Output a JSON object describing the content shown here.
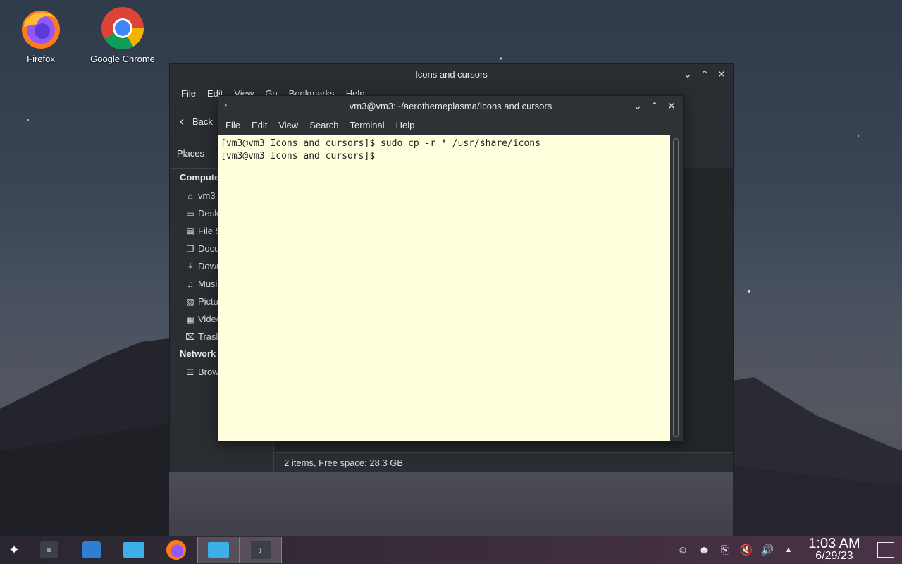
{
  "desktop": {
    "icons": [
      {
        "label": "Firefox",
        "icon": "firefox-icon"
      },
      {
        "label": "Google Chrome",
        "icon": "chrome-icon"
      }
    ]
  },
  "dolphin": {
    "title": "Icons and cursors",
    "menu": [
      "File",
      "Edit",
      "View",
      "Go",
      "Bookmarks",
      "Help"
    ],
    "back_label": "Back",
    "places_label": "Places",
    "sections": [
      {
        "title": "Computer",
        "items": [
          {
            "label": "vm3",
            "icon": "home-icon"
          },
          {
            "label": "Desktop",
            "icon": "desktop-icon"
          },
          {
            "label": "File System",
            "icon": "drive-icon"
          },
          {
            "label": "Documents",
            "icon": "documents-icon"
          },
          {
            "label": "Downloads",
            "icon": "download-icon"
          },
          {
            "label": "Music",
            "icon": "music-icon"
          },
          {
            "label": "Pictures",
            "icon": "pictures-icon"
          },
          {
            "label": "Videos",
            "icon": "videos-icon"
          },
          {
            "label": "Trash",
            "icon": "trash-icon"
          }
        ]
      },
      {
        "title": "Network",
        "items": [
          {
            "label": "Browse",
            "icon": "network-icon"
          }
        ]
      }
    ],
    "status": "2 items, Free space: 28.3 GB"
  },
  "terminal": {
    "title": "vm3@vm3:~/aerothemeplasma/Icons and cursors",
    "menu": [
      "File",
      "Edit",
      "View",
      "Search",
      "Terminal",
      "Help"
    ],
    "lines": [
      "[vm3@vm3 Icons and cursors]$ sudo cp -r * /usr/share/icons",
      "[vm3@vm3 Icons and cursors]$ "
    ]
  },
  "taskbar": {
    "time": "1:03 AM",
    "date": "6/29/23"
  },
  "colors": {
    "terminal_bg": "#ffffdd",
    "window_bg": "#2a2e32"
  }
}
